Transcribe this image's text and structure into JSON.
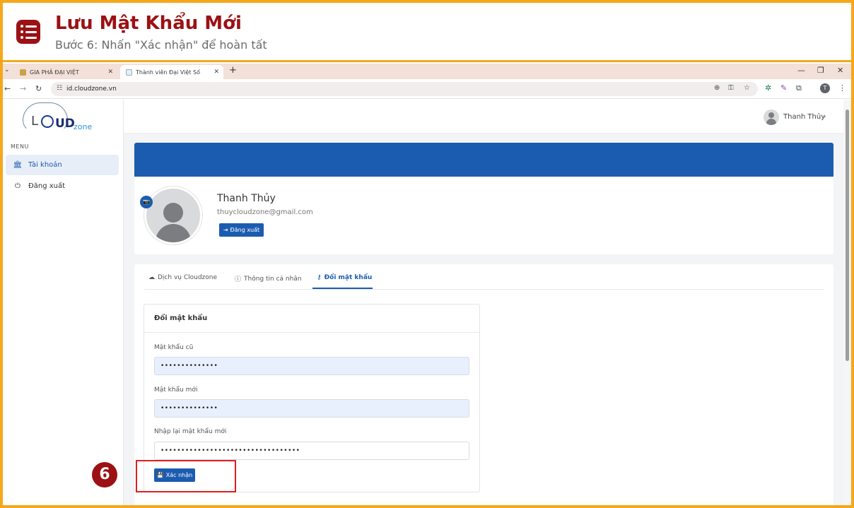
{
  "tutorial": {
    "title": "Lưu Mật Khẩu Mới",
    "subtitle": "Bước 6: Nhấn \"Xác nhận\" để hoàn tất",
    "step_number": "6"
  },
  "browser": {
    "tabs": [
      {
        "label": "GIA PHẢ ĐẠI VIỆT",
        "active": false
      },
      {
        "label": "Thành viên Đại Việt Số",
        "active": true
      }
    ],
    "url": "id.cloudzone.vn",
    "profile_initial": "T"
  },
  "sidebar": {
    "menu_label": "MENU",
    "items": [
      {
        "label": "Tài khoản",
        "active": true
      },
      {
        "label": "Đăng xuất",
        "active": false
      }
    ]
  },
  "header": {
    "user_name": "Thanh Thủy"
  },
  "profile": {
    "name": "Thanh Thủy",
    "email": "thuycloudzone@gmail.com",
    "logout_label": "Đăng xuất"
  },
  "tabs": [
    {
      "label": "Dịch vụ Cloudzone",
      "active": false
    },
    {
      "label": "Thông tin cá nhân",
      "active": false
    },
    {
      "label": "Đổi mật khẩu",
      "active": true
    }
  ],
  "password_form": {
    "title": "Đổi mật khẩu",
    "old_label": "Mật khẩu cũ",
    "old_value": "••••••••••••••",
    "new_label": "Mật khẩu mới",
    "new_value": "••••••••••••••",
    "confirm_label": "Nhập lại mật khẩu mới",
    "confirm_value": "••••••••••••••••••••••••••••••••••",
    "submit_label": "Xác nhận"
  },
  "colors": {
    "accent": "#1b5cb0",
    "tutorial_red": "#9b1114",
    "frame_orange": "#f5a71c",
    "highlight_red": "#e21d1d"
  }
}
